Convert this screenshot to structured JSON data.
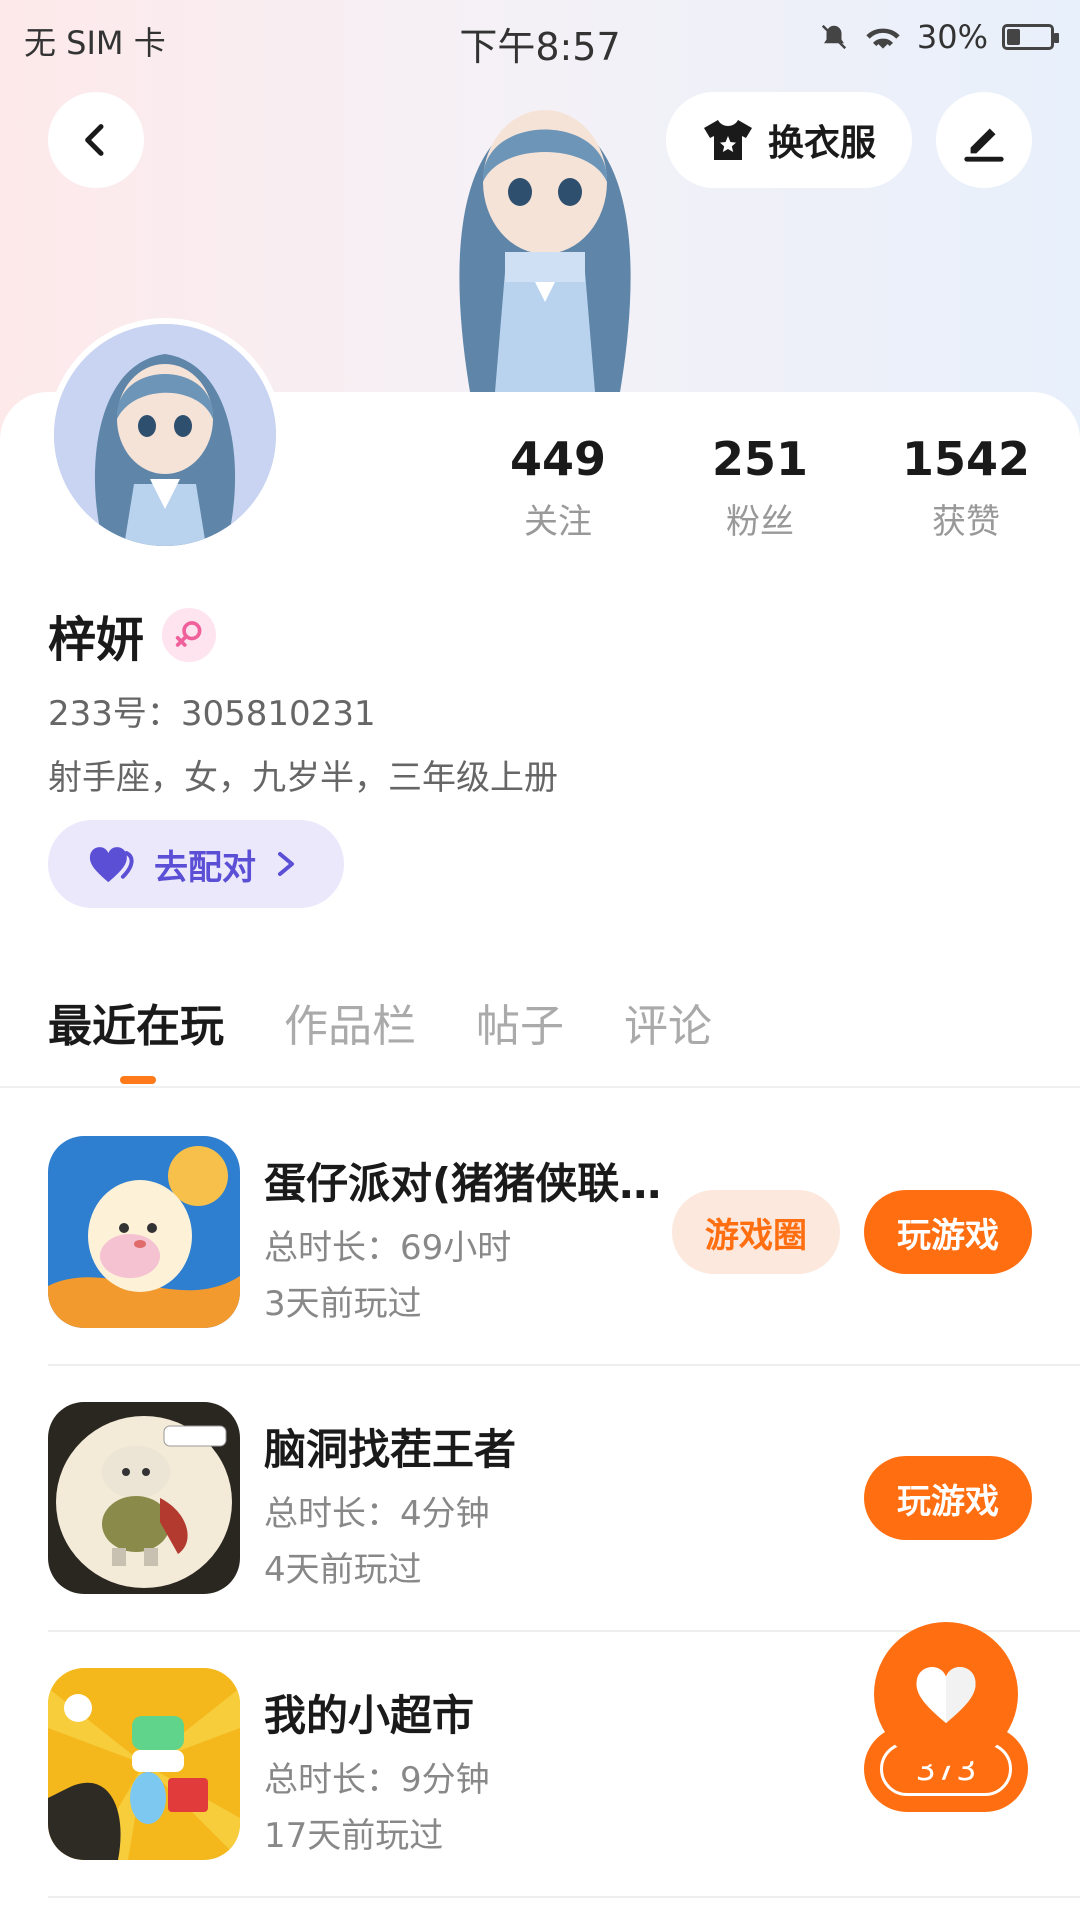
{
  "status_bar": {
    "carrier": "无 SIM 卡",
    "time": "下午8:57",
    "battery": "30%",
    "battery_level": 0.3
  },
  "header": {
    "dress_label": "换衣服"
  },
  "stats": [
    {
      "value": "449",
      "label": "关注"
    },
    {
      "value": "251",
      "label": "粉丝"
    },
    {
      "value": "1542",
      "label": "获赞"
    }
  ],
  "profile": {
    "name": "梓妍",
    "uid": "233号：305810231",
    "bio": "射手座，女，九岁半，三年级上册",
    "match_label": "去配对"
  },
  "tabs": [
    {
      "label": "最近在玩",
      "active": true
    },
    {
      "label": "作品栏",
      "active": false
    },
    {
      "label": "帖子",
      "active": false
    },
    {
      "label": "评论",
      "active": false
    }
  ],
  "games": [
    {
      "title": "蛋仔派对(猪猪侠联...",
      "duration": "总时长：69小时",
      "last_played": "3天前玩过",
      "circle_label": "游戏圈",
      "play_label": "玩游戏"
    },
    {
      "title": "脑洞找茬王者",
      "duration": "总时长：4分钟",
      "last_played": "4天前玩过",
      "play_label": "玩游戏"
    },
    {
      "title": "我的小超市",
      "duration": "总时长：9分钟",
      "last_played": "17天前玩过"
    }
  ],
  "like_fab": {
    "count": "373"
  },
  "colors": {
    "accent": "#ff6f12",
    "match": "#5b4fd6",
    "match_bg": "#ece8fc",
    "circle_bg": "#fde8dd"
  },
  "icons": [
    "back-icon",
    "shirt-icon",
    "edit-icon",
    "female-icon",
    "heart-icon",
    "chevron-right-icon",
    "like-heart-icon",
    "bell-off-icon",
    "wifi-icon",
    "battery-icon"
  ]
}
